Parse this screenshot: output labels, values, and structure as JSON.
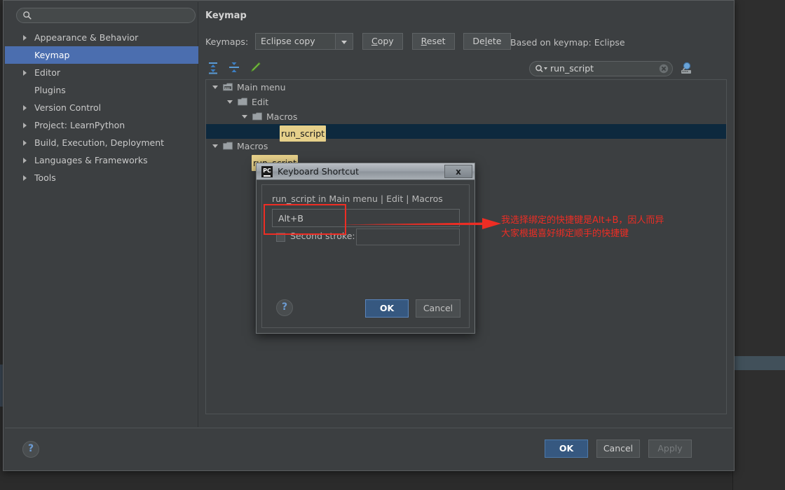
{
  "settings": {
    "sidebar": {
      "search_placeholder": "",
      "search_value": "",
      "search_icon": "search-icon",
      "items": [
        {
          "label": "Appearance & Behavior",
          "expandable": true,
          "selected": false
        },
        {
          "label": "Keymap",
          "expandable": false,
          "selected": true
        },
        {
          "label": "Editor",
          "expandable": true,
          "selected": false
        },
        {
          "label": "Plugins",
          "expandable": false,
          "selected": false
        },
        {
          "label": "Version Control",
          "expandable": true,
          "selected": false
        },
        {
          "label": "Project: LearnPython",
          "expandable": true,
          "selected": false
        },
        {
          "label": "Build, Execution, Deployment",
          "expandable": true,
          "selected": false
        },
        {
          "label": "Languages & Frameworks",
          "expandable": true,
          "selected": false
        },
        {
          "label": "Tools",
          "expandable": true,
          "selected": false
        }
      ]
    },
    "page_title": "Keymap",
    "keymaps": {
      "label": "Keymaps:",
      "selected": "Eclipse copy",
      "options": [
        "Eclipse copy"
      ],
      "copy_button": "Copy",
      "reset_button": "Reset",
      "delete_button": "Delete",
      "based_on": "Based on keymap: Eclipse"
    },
    "toolbar_icons": [
      {
        "name": "expand-all-icon"
      },
      {
        "name": "collapse-all-icon"
      },
      {
        "name": "edit-shortcut-pencil-icon"
      }
    ],
    "filter": {
      "value": "run_script",
      "search_icon": "search-dropdown-icon",
      "clear_icon": "clear-icon",
      "find_by_shortcut_icon": "find-by-shortcut-icon"
    },
    "tree": [
      {
        "label": "Main menu",
        "indent": 0,
        "arrow": true,
        "folder": "main-menu-folder",
        "highlight": false,
        "selected": false
      },
      {
        "label": "Edit",
        "indent": 1,
        "arrow": true,
        "folder": "folder",
        "highlight": false,
        "selected": false
      },
      {
        "label": "Macros",
        "indent": 2,
        "arrow": true,
        "folder": "folder",
        "highlight": false,
        "selected": false
      },
      {
        "label": "run_script",
        "indent": 3,
        "arrow": false,
        "folder": "",
        "highlight": true,
        "selected": true
      },
      {
        "label": "Macros",
        "indent": 0,
        "arrow": true,
        "folder": "main-menu-folder",
        "highlight": false,
        "selected": false
      },
      {
        "label": "run_script",
        "indent": 1,
        "arrow": false,
        "folder": "",
        "highlight": true,
        "selected": false
      }
    ],
    "footer": {
      "help_icon": "?",
      "ok_button": "OK",
      "cancel_button": "Cancel",
      "apply_button": "Apply"
    }
  },
  "keyboard_shortcut_dialog": {
    "app_icon": "pycharm-icon",
    "app_icon_text": "PC",
    "title": "Keyboard Shortcut",
    "close_button": "x",
    "context": "run_script in Main menu | Edit | Macros",
    "first_stroke_value": "Alt+B",
    "second_stroke_label": "Second stroke:",
    "second_stroke_checked": false,
    "second_stroke_value": "",
    "help_icon": "?",
    "ok_button": "OK",
    "cancel_button": "Cancel"
  },
  "annotation": {
    "line1": "我选择绑定的快捷键是Alt+B，因人而异",
    "line2": "大家根据喜好绑定顺手的快捷键",
    "color": "#ee2d24"
  }
}
